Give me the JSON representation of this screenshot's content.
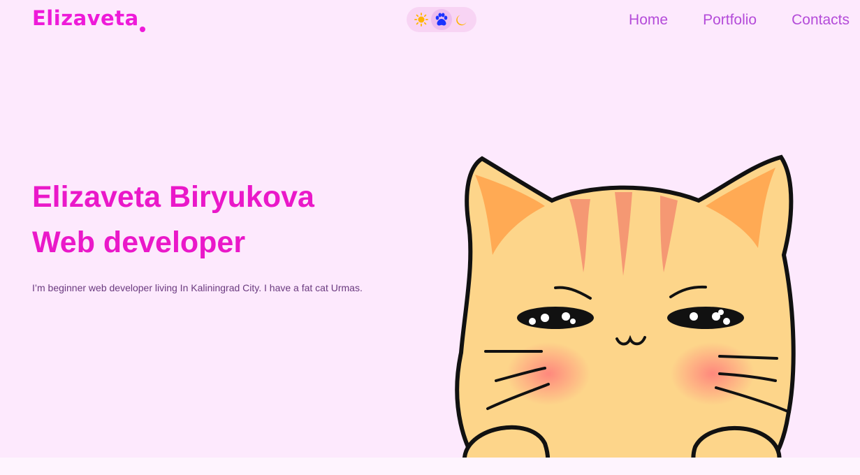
{
  "header": {
    "logo": "Elizaveta",
    "theme_switch": {
      "options": [
        {
          "name": "light",
          "icon": "sun-icon"
        },
        {
          "name": "paw",
          "icon": "paw-icon"
        },
        {
          "name": "dark",
          "icon": "moon-icon"
        }
      ],
      "active": "paw"
    },
    "nav": [
      {
        "label": "Home"
      },
      {
        "label": "Portfolio"
      },
      {
        "label": "Contacts"
      }
    ]
  },
  "hero": {
    "name": "Elizaveta Biryukova",
    "role": "Web developer",
    "description": "I’m beginner web developer living In Kaliningrad City. I have a fat cat Urmas."
  },
  "illustration": {
    "icon": "cat-illustration"
  },
  "colors": {
    "background": "#fde9fd",
    "accent": "#ee1ad9",
    "nav": "#b44bd9",
    "text": "#6a3a7f"
  }
}
